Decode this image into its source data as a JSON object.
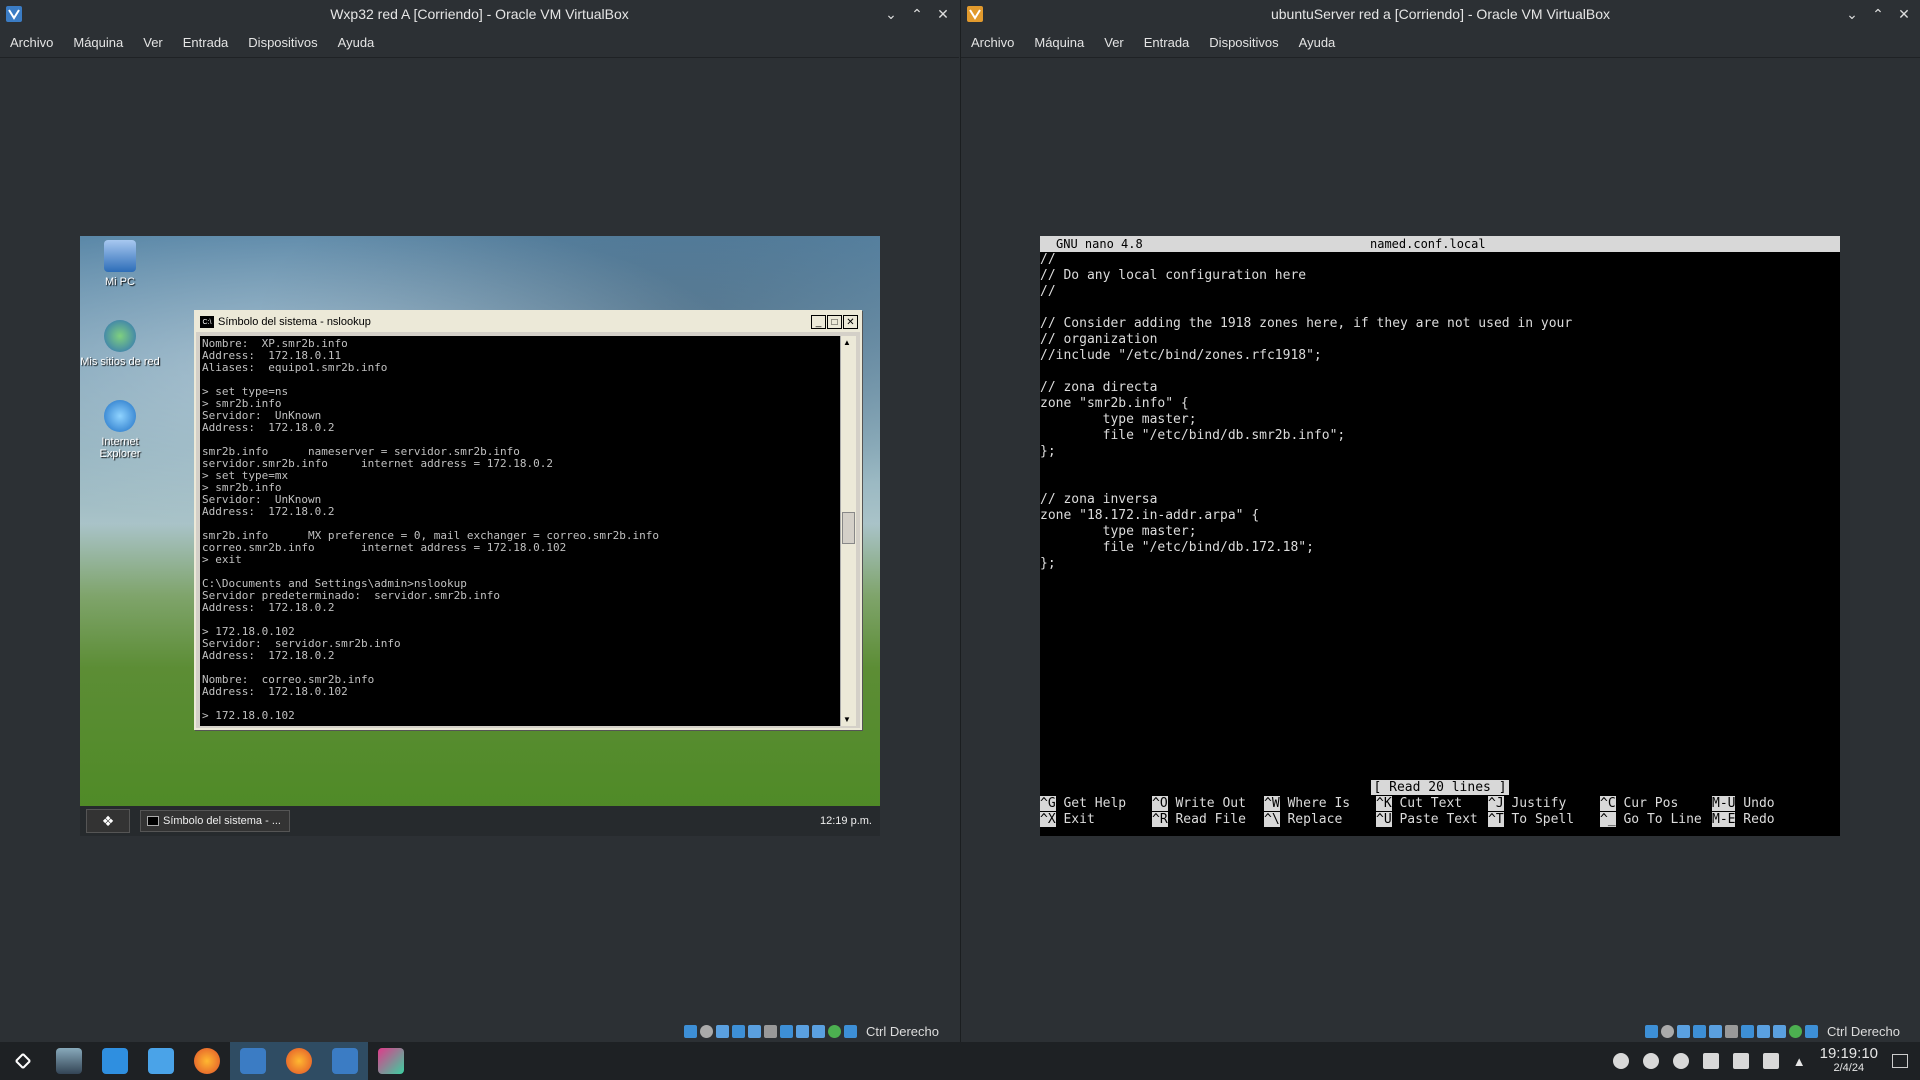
{
  "left_window": {
    "title": "Wxp32 red A [Corriendo] - Oracle VM VirtualBox",
    "menu": [
      "Archivo",
      "Máquina",
      "Ver",
      "Entrada",
      "Dispositivos",
      "Ayuda"
    ],
    "host_key": "Ctrl Derecho"
  },
  "right_window": {
    "title": "ubuntuServer red a [Corriendo] - Oracle VM VirtualBox",
    "menu": [
      "Archivo",
      "Máquina",
      "Ver",
      "Entrada",
      "Dispositivos",
      "Ayuda"
    ],
    "host_key": "Ctrl Derecho"
  },
  "xp": {
    "desktop_icons": [
      {
        "label": "Mi PC",
        "icon": "my-computer-icon"
      },
      {
        "label": "Mis sitios de red",
        "icon": "network-places-icon"
      },
      {
        "label": "Internet Explorer",
        "icon": "internet-explorer-icon"
      }
    ],
    "cmd_title": "Símbolo del sistema - nslookup",
    "cmd_lines": [
      "Nombre:  XP.smr2b.info",
      "Address:  172.18.0.11",
      "Aliases:  equipo1.smr2b.info",
      "",
      "> set type=ns",
      "> smr2b.info",
      "Servidor:  UnKnown",
      "Address:  172.18.0.2",
      "",
      "smr2b.info      nameserver = servidor.smr2b.info",
      "servidor.smr2b.info     internet address = 172.18.0.2",
      "> set type=mx",
      "> smr2b.info",
      "Servidor:  UnKnown",
      "Address:  172.18.0.2",
      "",
      "smr2b.info      MX preference = 0, mail exchanger = correo.smr2b.info",
      "correo.smr2b.info       internet address = 172.18.0.102",
      "> exit",
      "",
      "C:\\Documents and Settings\\admin>nslookup",
      "Servidor predeterminado:  servidor.smr2b.info",
      "Address:  172.18.0.2",
      "",
      "> 172.18.0.102",
      "Servidor:  servidor.smr2b.info",
      "Address:  172.18.0.2",
      "",
      "Nombre:  correo.smr2b.info",
      "Address:  172.18.0.102",
      "",
      "> 172.18.0.102"
    ],
    "taskbar_task": "Símbolo del sistema - ...",
    "clock": "12:19 p.m."
  },
  "nano": {
    "version": "GNU nano 4.8",
    "filename": "named.conf.local",
    "lines": [
      "//",
      "// Do any local configuration here",
      "//",
      "",
      "// Consider adding the 1918 zones here, if they are not used in your",
      "// organization",
      "//include \"/etc/bind/zones.rfc1918\";",
      "",
      "// zona directa",
      "zone \"smr2b.info\" {",
      "        type master;",
      "        file \"/etc/bind/db.smr2b.info\";",
      "};",
      "",
      "",
      "// zona inversa",
      "zone \"18.172.in-addr.arpa\" {",
      "        type master;",
      "        file \"/etc/bind/db.172.18\";",
      "};"
    ],
    "status": "[ Read 20 lines ]",
    "help_row1": [
      {
        "key": "^G",
        "label": "Get Help"
      },
      {
        "key": "^O",
        "label": "Write Out"
      },
      {
        "key": "^W",
        "label": "Where Is"
      },
      {
        "key": "^K",
        "label": "Cut Text"
      },
      {
        "key": "^J",
        "label": "Justify"
      },
      {
        "key": "^C",
        "label": "Cur Pos"
      },
      {
        "key": "M-U",
        "label": "Undo"
      }
    ],
    "help_row2": [
      {
        "key": "^X",
        "label": "Exit"
      },
      {
        "key": "^R",
        "label": "Read File"
      },
      {
        "key": "^\\",
        "label": "Replace"
      },
      {
        "key": "^U",
        "label": "Paste Text"
      },
      {
        "key": "^T",
        "label": "To Spell"
      },
      {
        "key": "^_",
        "label": "Go To Line"
      },
      {
        "key": "M-E",
        "label": "Redo"
      }
    ]
  },
  "host_taskbar": {
    "time": "19:19:10",
    "date": "2/4/24"
  }
}
